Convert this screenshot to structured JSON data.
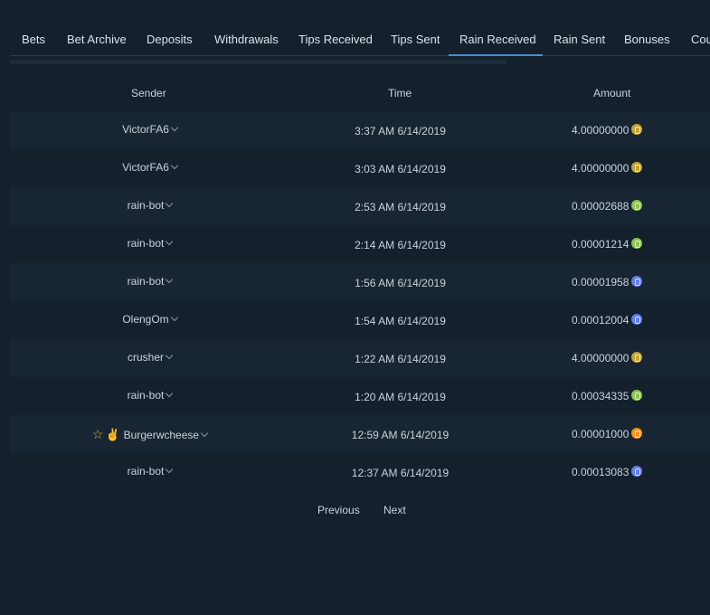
{
  "tabs": [
    {
      "label": "Bets"
    },
    {
      "label": "Bet Archive"
    },
    {
      "label": "Deposits"
    },
    {
      "label": "Withdrawals"
    },
    {
      "label": "Tips Received"
    },
    {
      "label": "Tips Sent"
    },
    {
      "label": "Rain Received",
      "active": true
    },
    {
      "label": "Rain Sent"
    },
    {
      "label": "Bonuses"
    },
    {
      "label": "Cou"
    }
  ],
  "table": {
    "headers": {
      "sender": "Sender",
      "time": "Time",
      "amount": "Amount"
    },
    "rows": [
      {
        "sender": "VictorFA6",
        "time": "3:37 AM 6/14/2019",
        "amount": "4.00000000",
        "coin": "dogecoin-icon",
        "coin_color": "#c2a633"
      },
      {
        "sender": "VictorFA6",
        "time": "3:03 AM 6/14/2019",
        "amount": "4.00000000",
        "coin": "dogecoin-icon",
        "coin_color": "#c2a633"
      },
      {
        "sender": "rain-bot",
        "time": "2:53 AM 6/14/2019",
        "amount": "0.00002688",
        "coin": "bitcoin-cash-icon",
        "coin_color": "#8dc351"
      },
      {
        "sender": "rain-bot",
        "time": "2:14 AM 6/14/2019",
        "amount": "0.00001214",
        "coin": "bitcoin-cash-icon",
        "coin_color": "#8dc351"
      },
      {
        "sender": "rain-bot",
        "time": "1:56 AM 6/14/2019",
        "amount": "0.00001958",
        "coin": "ethereum-icon",
        "coin_color": "#627eea"
      },
      {
        "sender": "OlengOm",
        "time": "1:54 AM 6/14/2019",
        "amount": "0.00012004",
        "coin": "ethereum-icon",
        "coin_color": "#627eea"
      },
      {
        "sender": "crusher",
        "time": "1:22 AM 6/14/2019",
        "amount": "4.00000000",
        "coin": "dogecoin-icon",
        "coin_color": "#c2a633"
      },
      {
        "sender": "rain-bot",
        "time": "1:20 AM 6/14/2019",
        "amount": "0.00034335",
        "coin": "bitcoin-cash-icon",
        "coin_color": "#8dc351"
      },
      {
        "sender": "Burgerwcheese",
        "time": "12:59 AM 6/14/2019",
        "amount": "0.00001000",
        "coin": "bitcoin-icon",
        "coin_color": "#f7931a",
        "badges": true
      },
      {
        "sender": "rain-bot",
        "time": "12:37 AM 6/14/2019",
        "amount": "0.00013083",
        "coin": "ethereum-icon",
        "coin_color": "#627eea"
      }
    ]
  },
  "pagination": {
    "previous": "Previous",
    "next": "Next"
  },
  "colors": {
    "accent": "#4d8ad6",
    "background": "#14212d",
    "row_shade": "#182633"
  }
}
